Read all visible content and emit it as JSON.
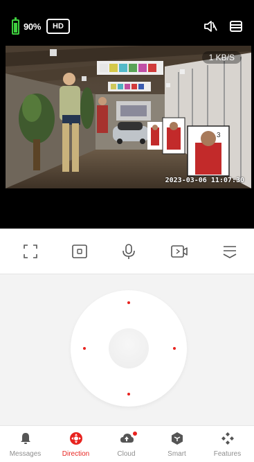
{
  "status": {
    "battery_percent": 0.9,
    "battery_text": "90%",
    "quality_badge": "HD",
    "mute_icon": "speaker-muted-icon",
    "layout_icon": "layout-list-icon"
  },
  "video": {
    "speed": "1 KB/S",
    "timestamp": "2023-03-06 11:07:30"
  },
  "controls": [
    {
      "name": "fullscreen",
      "icon": "fullscreen-icon"
    },
    {
      "name": "screenshot",
      "icon": "screenshot-icon"
    },
    {
      "name": "talk",
      "icon": "microphone-icon"
    },
    {
      "name": "record",
      "icon": "record-video-icon"
    },
    {
      "name": "more",
      "icon": "expand-menu-icon"
    }
  ],
  "tabs": [
    {
      "label": "Messages",
      "icon": "bell-icon",
      "active": false
    },
    {
      "label": "Direction",
      "icon": "direction-pad-icon",
      "active": true
    },
    {
      "label": "Cloud",
      "icon": "cloud-upload-icon",
      "active": false,
      "badge": true
    },
    {
      "label": "Smart",
      "icon": "smart-cube-icon",
      "active": false
    },
    {
      "label": "Features",
      "icon": "features-grid-icon",
      "active": false
    }
  ],
  "colors": {
    "accent": "#e8231f",
    "battery": "#3fcf3f"
  }
}
